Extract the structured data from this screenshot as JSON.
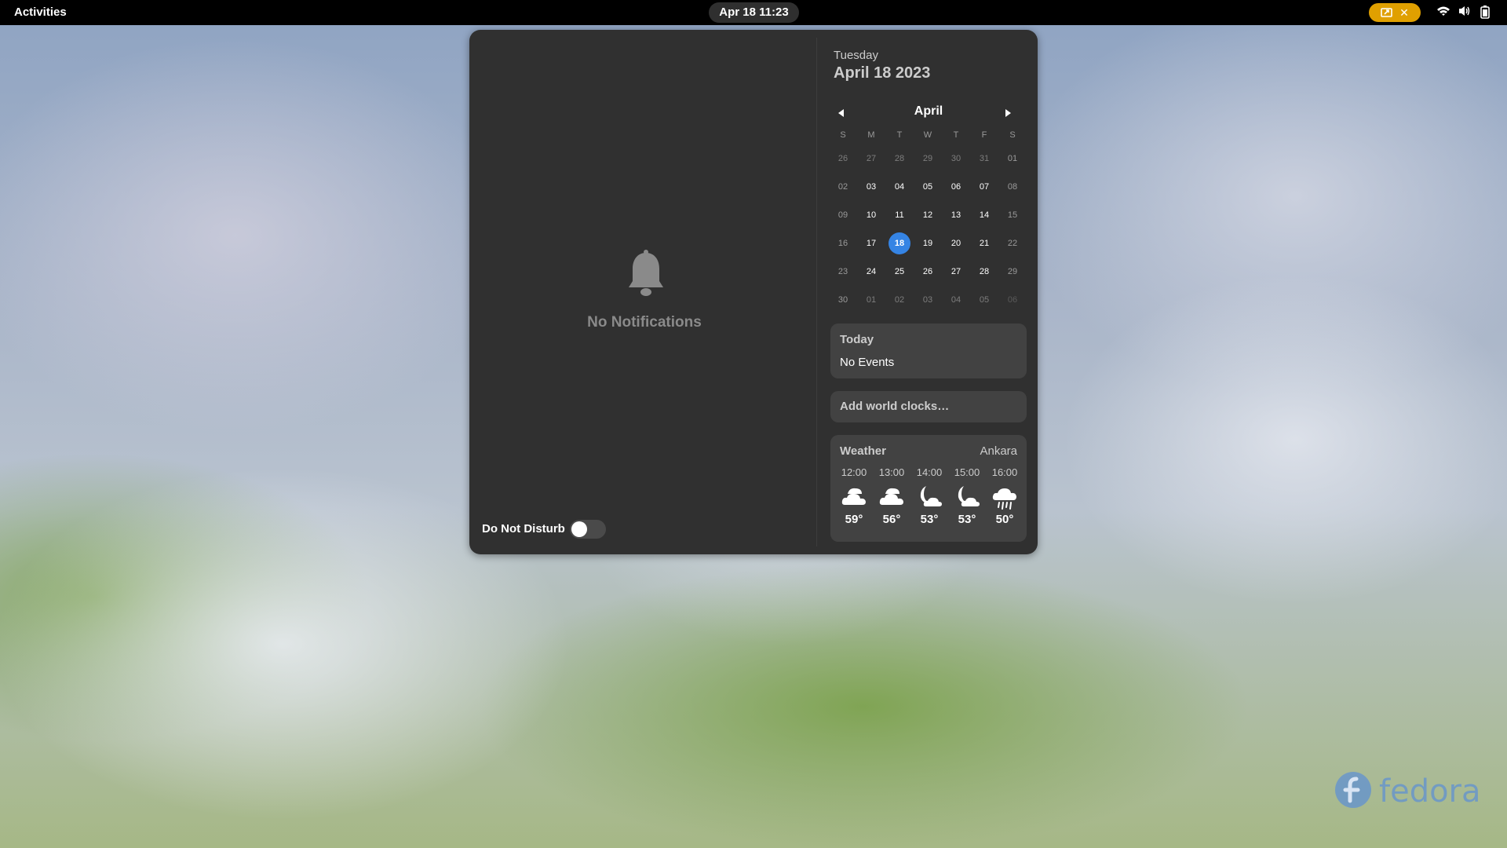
{
  "topbar": {
    "activities": "Activities",
    "clock": "Apr 18  11:23",
    "screencast_close": "✕"
  },
  "notifications": {
    "empty_label": "No Notifications",
    "dnd_label": "Do Not Disturb",
    "dnd_enabled": false
  },
  "calendar": {
    "weekday": "Tuesday",
    "full_date": "April 18 2023",
    "month": "April",
    "day_headers": [
      "S",
      "M",
      "T",
      "W",
      "T",
      "F",
      "S"
    ],
    "weeks": [
      [
        "26",
        "27",
        "28",
        "29",
        "30",
        "31",
        "01"
      ],
      [
        "02",
        "03",
        "04",
        "05",
        "06",
        "07",
        "08"
      ],
      [
        "09",
        "10",
        "11",
        "12",
        "13",
        "14",
        "15"
      ],
      [
        "16",
        "17",
        "18",
        "19",
        "20",
        "21",
        "22"
      ],
      [
        "23",
        "24",
        "25",
        "26",
        "27",
        "28",
        "29"
      ],
      [
        "30",
        "01",
        "02",
        "03",
        "04",
        "05",
        "06"
      ]
    ],
    "today": "18"
  },
  "events": {
    "title": "Today",
    "body": "No Events"
  },
  "world_clocks": {
    "label": "Add world clocks…"
  },
  "weather": {
    "title": "Weather",
    "location": "Ankara",
    "forecast": [
      {
        "time": "12:00",
        "temp": "59°",
        "icon": "partly-cloudy-icon"
      },
      {
        "time": "13:00",
        "temp": "56°",
        "icon": "partly-cloudy-icon"
      },
      {
        "time": "14:00",
        "temp": "53°",
        "icon": "night-cloudy-icon"
      },
      {
        "time": "15:00",
        "temp": "53°",
        "icon": "night-cloudy-icon"
      },
      {
        "time": "16:00",
        "temp": "50°",
        "icon": "rain-icon"
      }
    ]
  },
  "wallpaper": {
    "logo_text": "fedora"
  },
  "colors": {
    "accent": "#3584e4",
    "panel_bg": "#303030",
    "card_bg": "#424242",
    "screencast": "#e0a000"
  }
}
